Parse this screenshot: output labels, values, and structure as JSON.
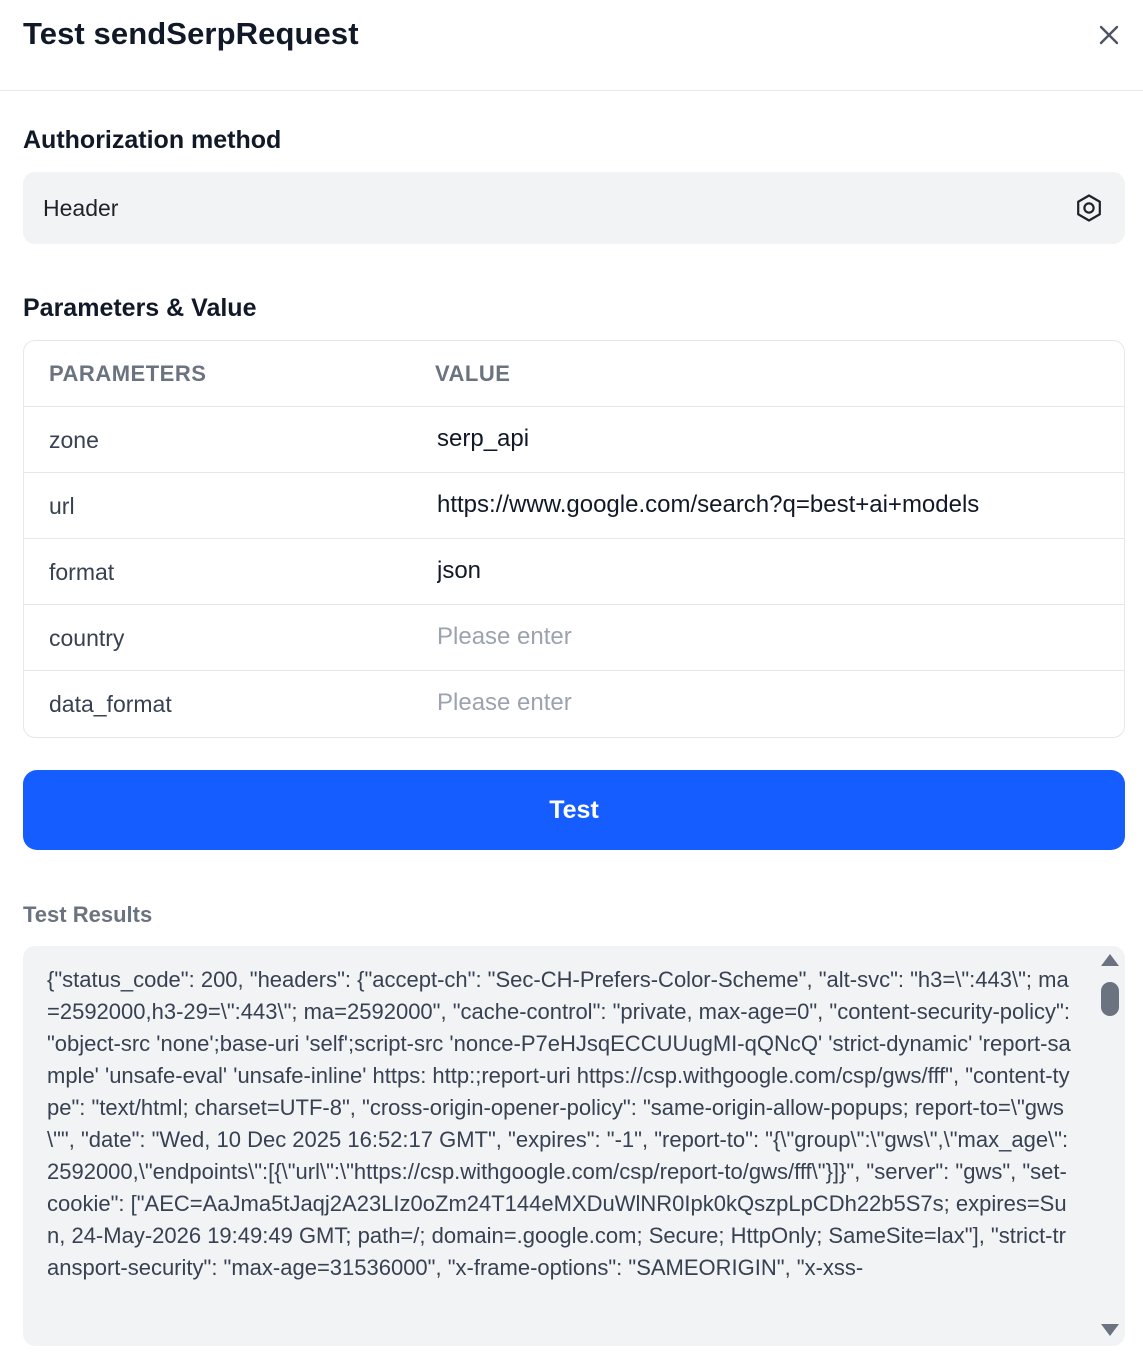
{
  "modal": {
    "title": "Test sendSerpRequest"
  },
  "auth": {
    "label": "Authorization method",
    "value": "Header"
  },
  "params": {
    "label": "Parameters & Value",
    "headers": [
      "PARAMETERS",
      "VALUE"
    ],
    "rows": [
      {
        "name": "zone",
        "value": "serp_api",
        "placeholder": "Please enter"
      },
      {
        "name": "url",
        "value": "https://www.google.com/search?q=best+ai+models",
        "placeholder": "Please enter"
      },
      {
        "name": "format",
        "value": "json",
        "placeholder": "Please enter"
      },
      {
        "name": "country",
        "value": "",
        "placeholder": "Please enter"
      },
      {
        "name": "data_format",
        "value": "",
        "placeholder": "Please enter"
      }
    ]
  },
  "actions": {
    "test_label": "Test"
  },
  "results": {
    "label": "Test Results",
    "text": "{\"status_code\": 200, \"headers\": {\"accept-ch\": \"Sec-CH-Prefers-Color-Scheme\", \"alt-svc\": \"h3=\\\":443\\\"; ma=2592000,h3-29=\\\":443\\\"; ma=2592000\", \"cache-control\": \"private, max-age=0\", \"content-security-policy\": \"object-src 'none';base-uri 'self';script-src 'nonce-P7eHJsqECCUUugMI-qQNcQ' 'strict-dynamic' 'report-sample' 'unsafe-eval' 'unsafe-inline' https: http:;report-uri https://csp.withgoogle.com/csp/gws/fff\", \"content-type\": \"text/html; charset=UTF-8\", \"cross-origin-opener-policy\": \"same-origin-allow-popups; report-to=\\\"gws\\\"\", \"date\": \"Wed, 10 Dec 2025 16:52:17 GMT\", \"expires\": \"-1\", \"report-to\": \"{\\\"group\\\":\\\"gws\\\",\\\"max_age\\\":2592000,\\\"endpoints\\\":[{\\\"url\\\":\\\"https://csp.withgoogle.com/csp/report-to/gws/fff\\\"}]}\", \"server\": \"gws\", \"set-cookie\": [\"AEC=AaJma5tJaqj2A23LIz0oZm24T144eMXDuWlNR0Ipk0kQszpLpCDh22b5S7s; expires=Sun, 24-May-2026 19:49:49 GMT; path=/; domain=.google.com; Secure; HttpOnly; SameSite=lax\"], \"strict-transport-security\": \"max-age=31536000\", \"x-frame-options\": \"SAMEORIGIN\", \"x-xss-"
  },
  "icons": {
    "close": "close-icon",
    "settings": "gear-icon"
  },
  "colors": {
    "primary": "#165dff",
    "field_bg": "#f2f3f5",
    "border": "#e5e7eb",
    "muted_text": "#6b7280",
    "placeholder": "#9ca3af"
  }
}
